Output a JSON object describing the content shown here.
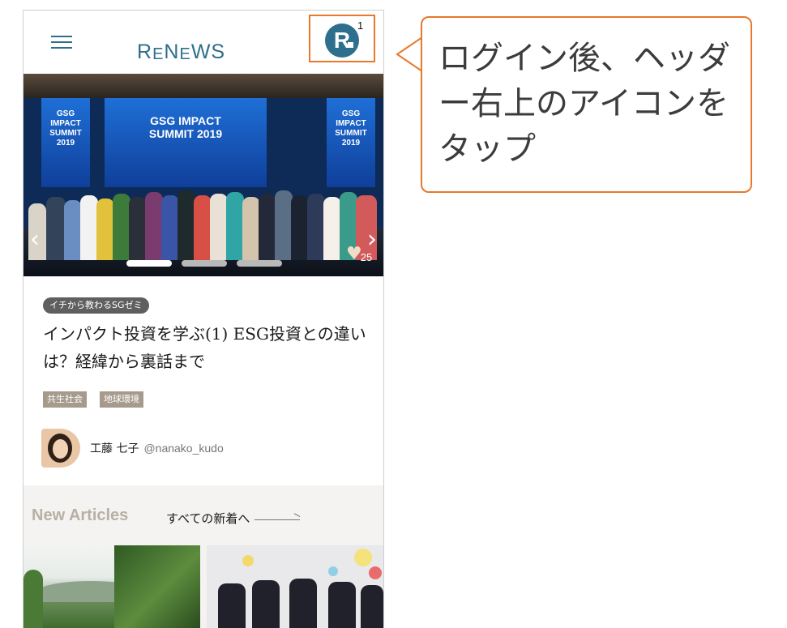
{
  "header": {
    "logo": {
      "r": "R",
      "e": "E",
      "n": "N",
      "e2": "E",
      "ws": "WS"
    },
    "avatar_letter": "R",
    "notification_count": "1"
  },
  "hero": {
    "slides": 3,
    "active_slide": 1,
    "likes": "25",
    "screen_text": "GSG IMPACT SUMMIT 2019"
  },
  "article": {
    "category": "イチから教わるSGゼミ",
    "title": "インパクト投資を学ぶ(1) ESG投資との違いは？経緯から裏話まで",
    "tags": [
      "共生社会",
      "地球環境"
    ],
    "author": {
      "name": "工藤 七子",
      "handle": "@nanako_kudo"
    }
  },
  "new_articles": {
    "title": "New Articles",
    "see_all": "すべての新着へ"
  },
  "callout": {
    "text": "ログイン後、ヘッダー右上のアイコンをタップ"
  },
  "colors": {
    "brand": "#2d6f8c",
    "highlight": "#e8782a",
    "tag_bg": "#a59a8c",
    "category_bg": "#5f5f5f"
  }
}
